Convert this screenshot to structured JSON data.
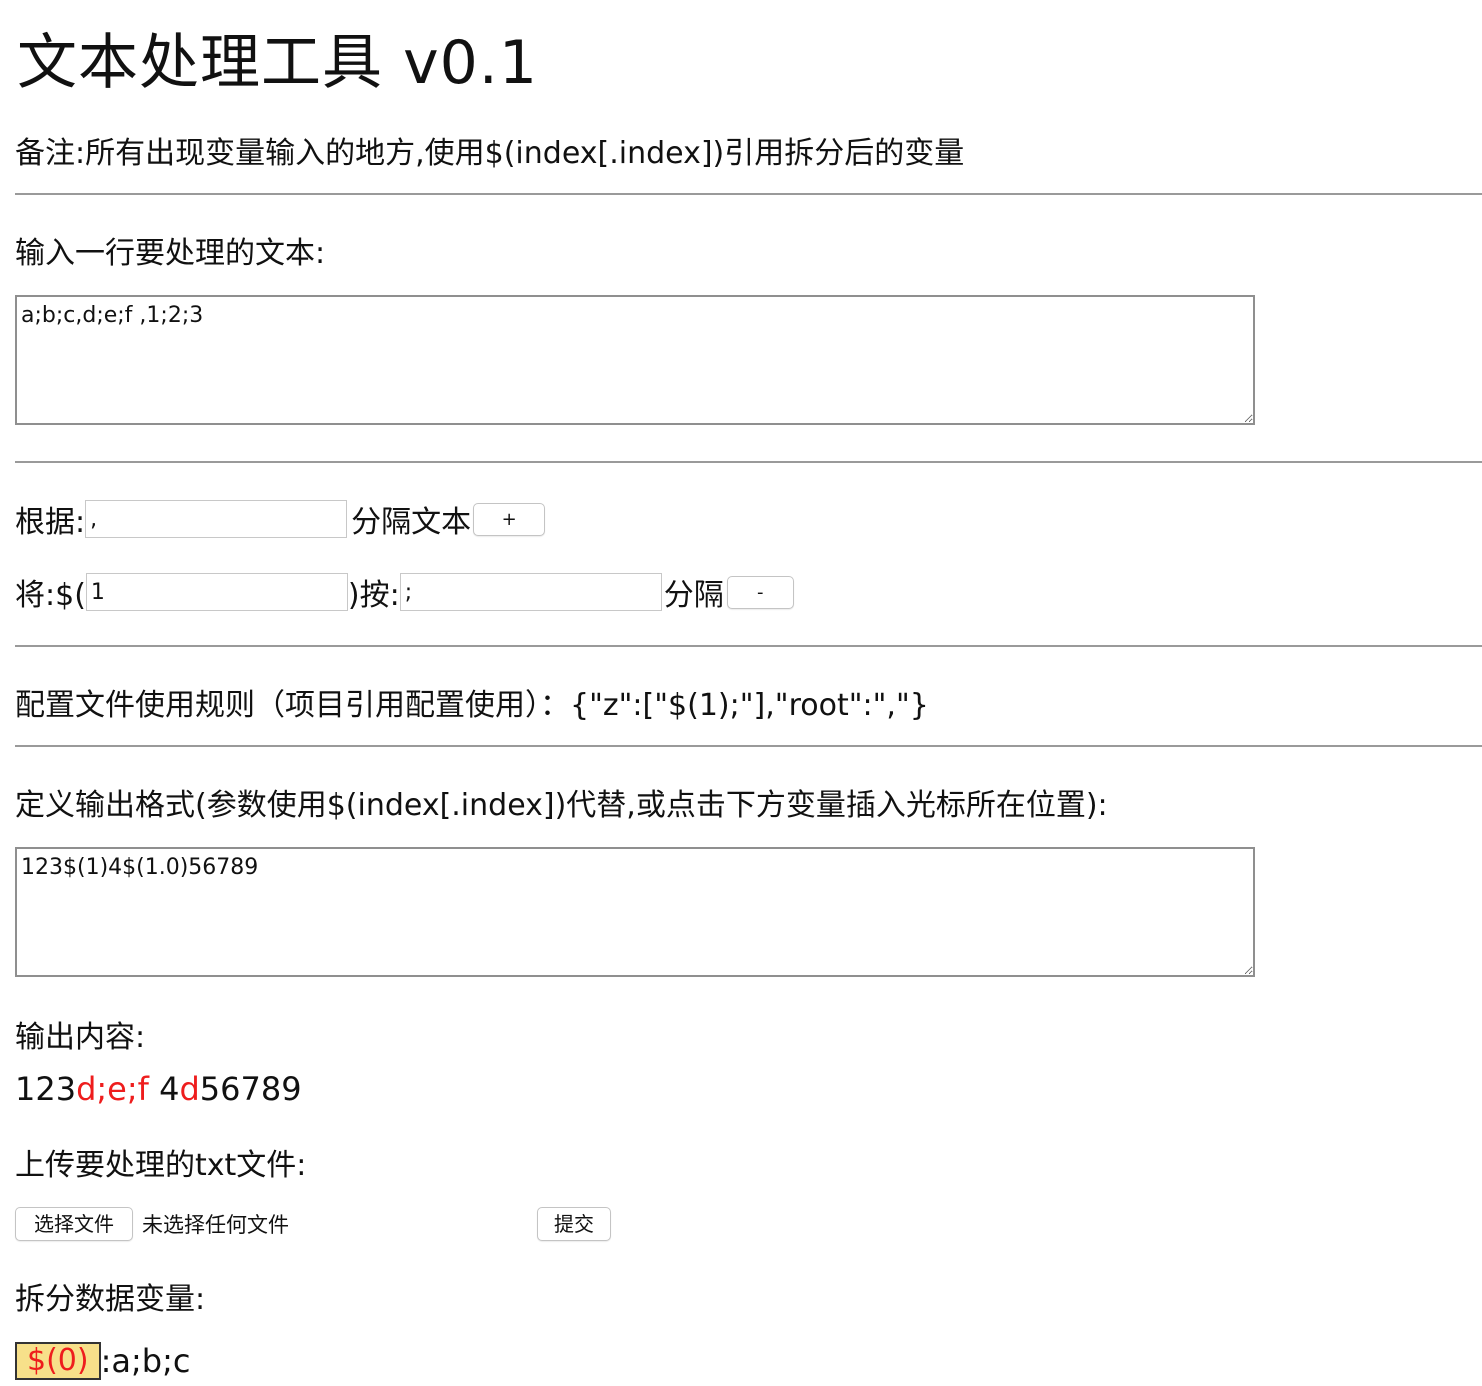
{
  "header": {
    "title": "文本处理工具 v0.1",
    "note": "备注:所有出现变量输入的地方,使用$(index[.index])引用拆分后的变量"
  },
  "input_section": {
    "label": "输入一行要处理的文本:",
    "value": "a;b;c,d;e;f ,1;2;3"
  },
  "split_section": {
    "by_label": "根据:",
    "by_value": ",",
    "split_text_label": "分隔文本",
    "add_button": "+",
    "take_label": "将:$(",
    "take_value": "1",
    "close_label": ")按:",
    "sep_value": ";",
    "split_label": "分隔",
    "remove_button": "-"
  },
  "config_section": {
    "text": "配置文件使用规则（项目引用配置使用）：{\"z\":[\"$(1);\"],\"root\":\",\"}"
  },
  "format_section": {
    "label": "定义输出格式(参数使用$(index[.index])代替,或点击下方变量插入光标所在位置):",
    "value": "123$(1)4$(1.0)56789"
  },
  "output_section": {
    "label": "输出内容:",
    "parts": [
      "123",
      "d;e;f ",
      "4",
      "d",
      "56789"
    ]
  },
  "upload_section": {
    "label": "上传要处理的txt文件:",
    "choose_button": "选择文件",
    "no_file_text": "未选择任何文件",
    "submit_button": "提交"
  },
  "variables_section": {
    "label": "拆分数据变量:",
    "items": [
      {
        "name": "$(0)",
        "value": ":a;b;c"
      }
    ]
  },
  "colors": {
    "highlight_text": "#ee1d1d",
    "variable_chip_bg": "#f7e08a",
    "separator": "#9a9a9a"
  }
}
